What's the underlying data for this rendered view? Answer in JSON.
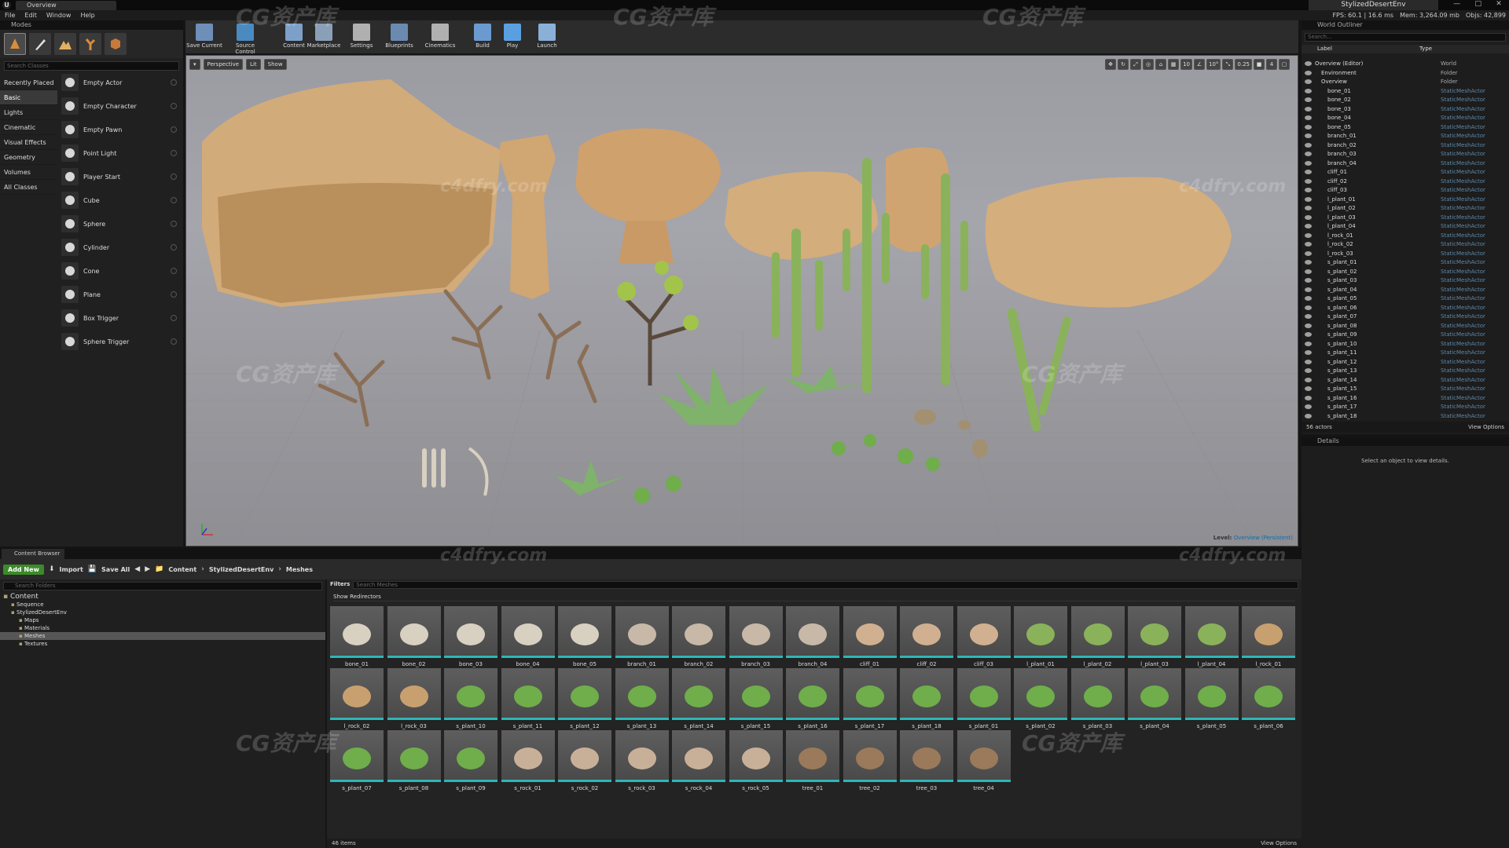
{
  "window": {
    "tab": "Overview",
    "project": "StylizedDesertEnv",
    "minimize": "—",
    "maximize": "□",
    "close": "✕"
  },
  "menu": [
    "File",
    "Edit",
    "Window",
    "Help"
  ],
  "stats": {
    "fps": "FPS: 60.1 | 16.6 ms",
    "mem": "Mem: 3,264.09 mb",
    "obj": "Objs: 42,899"
  },
  "modes": {
    "title": "Modes",
    "search_placeholder": "Search Classes",
    "categories": [
      "Recently Placed",
      "Basic",
      "Lights",
      "Cinematic",
      "Visual Effects",
      "Geometry",
      "Volumes",
      "All Classes"
    ],
    "selected_category": "Basic",
    "items": [
      "Empty Actor",
      "Empty Character",
      "Empty Pawn",
      "Point Light",
      "Player Start",
      "Cube",
      "Sphere",
      "Cylinder",
      "Cone",
      "Plane",
      "Box Trigger",
      "Sphere Trigger"
    ]
  },
  "toolbar": {
    "buttons": [
      "Save Current",
      "Source Control",
      "Content",
      "Marketplace",
      "Settings",
      "Blueprints",
      "Cinematics",
      "Build",
      "Play",
      "Launch"
    ]
  },
  "viewport": {
    "perspective": "Perspective",
    "lit": "Lit",
    "show": "Show",
    "grid_snap": "10",
    "rot_snap": "10°",
    "scale_snap": "0.25",
    "cam_speed": "4",
    "level_label": "Level:",
    "level_name": "Overview (Persistent)"
  },
  "outliner": {
    "title": "World Outliner",
    "search_placeholder": "Search...",
    "col_label": "Label",
    "col_type": "Type",
    "rows": [
      {
        "label": "Overview (Editor)",
        "type": "World"
      },
      {
        "label": "Environment",
        "type": "Folder"
      },
      {
        "label": "Overview",
        "type": "Folder"
      },
      {
        "label": "bone_01",
        "type": "StaticMeshActor"
      },
      {
        "label": "bone_02",
        "type": "StaticMeshActor"
      },
      {
        "label": "bone_03",
        "type": "StaticMeshActor"
      },
      {
        "label": "bone_04",
        "type": "StaticMeshActor"
      },
      {
        "label": "bone_05",
        "type": "StaticMeshActor"
      },
      {
        "label": "branch_01",
        "type": "StaticMeshActor"
      },
      {
        "label": "branch_02",
        "type": "StaticMeshActor"
      },
      {
        "label": "branch_03",
        "type": "StaticMeshActor"
      },
      {
        "label": "branch_04",
        "type": "StaticMeshActor"
      },
      {
        "label": "cliff_01",
        "type": "StaticMeshActor"
      },
      {
        "label": "cliff_02",
        "type": "StaticMeshActor"
      },
      {
        "label": "cliff_03",
        "type": "StaticMeshActor"
      },
      {
        "label": "l_plant_01",
        "type": "StaticMeshActor"
      },
      {
        "label": "l_plant_02",
        "type": "StaticMeshActor"
      },
      {
        "label": "l_plant_03",
        "type": "StaticMeshActor"
      },
      {
        "label": "l_plant_04",
        "type": "StaticMeshActor"
      },
      {
        "label": "l_rock_01",
        "type": "StaticMeshActor"
      },
      {
        "label": "l_rock_02",
        "type": "StaticMeshActor"
      },
      {
        "label": "l_rock_03",
        "type": "StaticMeshActor"
      },
      {
        "label": "s_plant_01",
        "type": "StaticMeshActor"
      },
      {
        "label": "s_plant_02",
        "type": "StaticMeshActor"
      },
      {
        "label": "s_plant_03",
        "type": "StaticMeshActor"
      },
      {
        "label": "s_plant_04",
        "type": "StaticMeshActor"
      },
      {
        "label": "s_plant_05",
        "type": "StaticMeshActor"
      },
      {
        "label": "s_plant_06",
        "type": "StaticMeshActor"
      },
      {
        "label": "s_plant_07",
        "type": "StaticMeshActor"
      },
      {
        "label": "s_plant_08",
        "type": "StaticMeshActor"
      },
      {
        "label": "s_plant_09",
        "type": "StaticMeshActor"
      },
      {
        "label": "s_plant_10",
        "type": "StaticMeshActor"
      },
      {
        "label": "s_plant_11",
        "type": "StaticMeshActor"
      },
      {
        "label": "s_plant_12",
        "type": "StaticMeshActor"
      },
      {
        "label": "s_plant_13",
        "type": "StaticMeshActor"
      },
      {
        "label": "s_plant_14",
        "type": "StaticMeshActor"
      },
      {
        "label": "s_plant_15",
        "type": "StaticMeshActor"
      },
      {
        "label": "s_plant_16",
        "type": "StaticMeshActor"
      },
      {
        "label": "s_plant_17",
        "type": "StaticMeshActor"
      },
      {
        "label": "s_plant_18",
        "type": "StaticMeshActor"
      }
    ],
    "count": "56 actors",
    "view_options": "View Options"
  },
  "details": {
    "title": "Details",
    "message": "Select an object to view details."
  },
  "content_browser": {
    "tab": "Content Browser",
    "add_new": "Add New",
    "import": "Import",
    "save_all": "Save All",
    "path": [
      "Content",
      "StylizedDesertEnv",
      "Meshes"
    ],
    "folder_search": "Search Folders",
    "folders": [
      {
        "name": "Content",
        "depth": 0
      },
      {
        "name": "Sequence",
        "depth": 1
      },
      {
        "name": "StylizedDesertEnv",
        "depth": 1
      },
      {
        "name": "Maps",
        "depth": 2
      },
      {
        "name": "Materials",
        "depth": 2
      },
      {
        "name": "Meshes",
        "depth": 2,
        "selected": true
      },
      {
        "name": "Textures",
        "depth": 2
      }
    ],
    "filters": "Filters",
    "asset_search": "Search Meshes",
    "show_redirectors": "Show Redirectors",
    "assets": [
      "bone_01",
      "bone_02",
      "bone_03",
      "bone_04",
      "bone_05",
      "branch_01",
      "branch_02",
      "branch_03",
      "branch_04",
      "cliff_01",
      "cliff_02",
      "cliff_03",
      "l_plant_01",
      "l_plant_02",
      "l_plant_03",
      "l_plant_04",
      "l_rock_01",
      "l_rock_02",
      "l_rock_03",
      "s_plant_10",
      "s_plant_11",
      "s_plant_12",
      "s_plant_13",
      "s_plant_14",
      "s_plant_15",
      "s_plant_16",
      "s_plant_17",
      "s_plant_18",
      "s_plant_01",
      "s_plant_02",
      "s_plant_03",
      "s_plant_04",
      "s_plant_05",
      "s_plant_06",
      "s_plant_07",
      "s_plant_08",
      "s_plant_09",
      "s_rock_01",
      "s_rock_02",
      "s_rock_03",
      "s_rock_04",
      "s_rock_05",
      "tree_01",
      "tree_02",
      "tree_03",
      "tree_04"
    ],
    "item_count": "46 items",
    "view_options": "View Options"
  },
  "watermarks": [
    "CG资产库",
    "c4dfry.com"
  ]
}
